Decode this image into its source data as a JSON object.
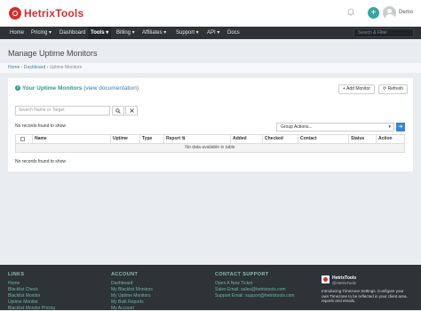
{
  "header": {
    "brand": "HetrixTools",
    "plus": "+",
    "username": "Demo"
  },
  "nav": {
    "items": [
      "Home",
      "Pricing ▾",
      "Dashboard",
      "Tools ▾",
      "Billing ▾",
      "Affiliates ▾",
      "Support ▾",
      "API ▾",
      "Docs"
    ],
    "search_placeholder": "Search & Filter"
  },
  "page": {
    "title": "Manage Uptime Monitors",
    "breadcrumb": [
      "Home",
      "Dashboard",
      "Uptime Monitors"
    ],
    "breadcrumb_sep": "›"
  },
  "panel": {
    "title": "Your Uptime Monitors",
    "doc_open": "(",
    "doc_link": "view documentation",
    "doc_close": ")",
    "add_monitor": "+ Add Monitor",
    "refresh": "⟳ Refresh",
    "search_placeholder": "Search Name or Target",
    "search_icon": "search-icon",
    "clear_icon": "close-icon",
    "no_records_top": "No records found to show",
    "group_actions": "Group Actions...",
    "go": "➜",
    "columns": [
      "Name",
      "Uptime",
      "Type",
      "Report ⇅",
      "Added",
      "Checked",
      "Contact",
      "Status",
      "Action"
    ],
    "empty_message": "No data available in table",
    "no_records_bottom": "No records found to show"
  },
  "footer": {
    "links_heading": "LINKS",
    "links": [
      "Home",
      "Blacklist Check",
      "Blacklist Monitor",
      "Uptime Monitor",
      "Blacklist Monitor Pricing"
    ],
    "account_heading": "ACCOUNT",
    "account": [
      "Dashboard",
      "My Blacklist Monitors",
      "My Uptime Monitors",
      "My Bulk Reports",
      "My Account"
    ],
    "contact_heading": "CONTACT SUPPORT",
    "contact": [
      "Open A New Ticket",
      "Sales Email: sales@hetrixtools.com",
      "Support Email: support@hetrixtools.com"
    ],
    "twitter_name": "HetrixTools",
    "twitter_handle": "@HetrixTools",
    "tweet": "Introducing Timezone Settings. Configure your own Timezone to be reflected in your client area, reports and emails."
  },
  "colors": {
    "brand_red": "#d32f2f",
    "teal": "#2f9a90",
    "nav_bg": "#2d3336",
    "link_blue": "#3a7bbf"
  }
}
